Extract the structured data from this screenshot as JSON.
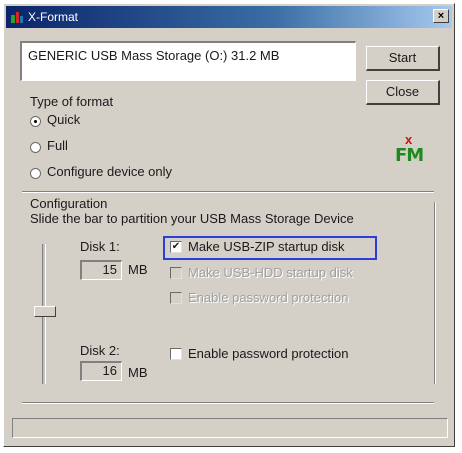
{
  "window": {
    "title": "X-Format",
    "close_glyph": "×"
  },
  "device": {
    "text": "GENERIC USB Mass Storage (O:) 31.2 MB"
  },
  "buttons": {
    "start": "Start",
    "close": "Close"
  },
  "format": {
    "heading": "Type of format",
    "options": [
      {
        "label": "Quick",
        "selected": true
      },
      {
        "label": "Full",
        "selected": false
      },
      {
        "label": "Configure device only",
        "selected": false
      }
    ]
  },
  "logo": {
    "letters": "FM",
    "mark": "x"
  },
  "configuration": {
    "heading": "Configuration",
    "subtitle": "Slide the bar to partition your USB Mass Storage Device",
    "slider_position": 0.45,
    "disk1": {
      "label": "Disk 1:",
      "value": "15",
      "unit": "MB",
      "options": [
        {
          "label": "Make USB-ZIP startup disk",
          "checked": true,
          "enabled": true
        },
        {
          "label": "Make USB-HDD startup disk",
          "checked": false,
          "enabled": false
        },
        {
          "label": "Enable password protection",
          "checked": false,
          "enabled": false
        }
      ]
    },
    "disk2": {
      "label": "Disk 2:",
      "value": "16",
      "unit": "MB",
      "options": [
        {
          "label": "Enable password protection",
          "checked": false,
          "enabled": true
        }
      ]
    }
  },
  "colors": {
    "highlight": "#2b3fd8",
    "titlebar": "#0a246a",
    "logo_green": "#1e8a1e",
    "logo_red": "#d01010"
  }
}
